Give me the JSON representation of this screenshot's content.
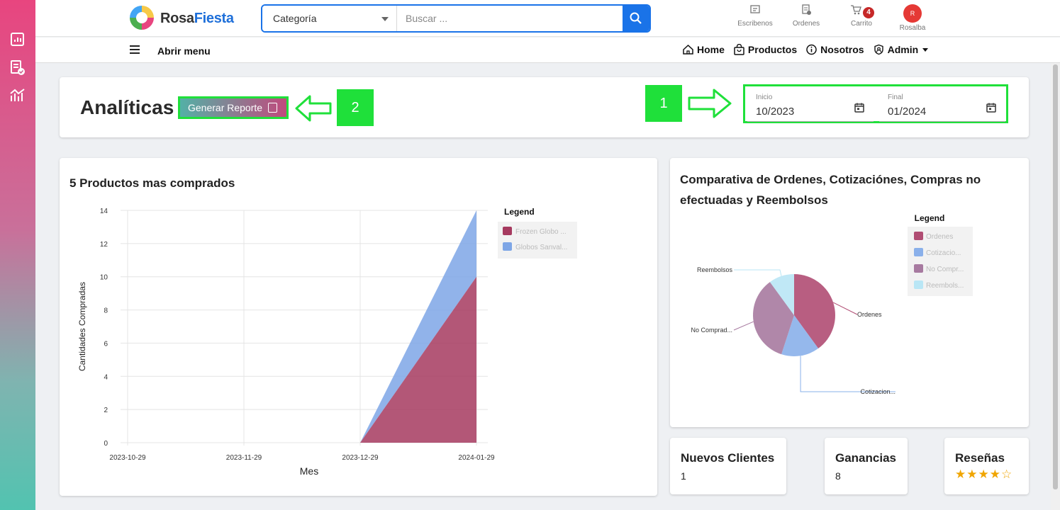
{
  "brand": {
    "part1": "Rosa",
    "part2": "Fiesta"
  },
  "search": {
    "category_label": "Categoría",
    "placeholder": "Buscar ..."
  },
  "header_icons": {
    "escribenos": "Escribenos",
    "ordenes": "Ordenes",
    "carrito": "Carrito",
    "cart_count": "4",
    "user": "Rosalba",
    "avatar_initial": "R"
  },
  "nav": {
    "menu_label": "Abrir menu",
    "home": "Home",
    "productos": "Productos",
    "nosotros": "Nosotros",
    "admin": "Admin"
  },
  "page": {
    "title": "Analíticas",
    "report_button": "Generar Reporte"
  },
  "annotations": {
    "step1": "1",
    "step2": "2"
  },
  "dates": {
    "start_label": "Inicio",
    "start_value": "10/2023",
    "end_label": "Final",
    "end_value": "01/2024"
  },
  "colors": {
    "accent_green": "#1fe03a",
    "series_red": "#a63a5f",
    "series_blue": "#7ea6e6",
    "pie_purple": "#a77aa0",
    "pie_cyan": "#b9e6f5"
  },
  "chart_data": [
    {
      "type": "area",
      "title": "5 Productos mas comprados",
      "xlabel": "Mes",
      "ylabel": "Cantidades Compradas",
      "legend_title": "Legend",
      "stacked": true,
      "x": [
        "2023-10-29",
        "2023-11-29",
        "2023-12-29",
        "2024-01-29"
      ],
      "ylim": [
        0,
        14
      ],
      "yticks": [
        0,
        2,
        4,
        6,
        8,
        10,
        12,
        14
      ],
      "series": [
        {
          "name": "Frozen Globo ...",
          "values": [
            0,
            0,
            0,
            10
          ],
          "color": "#a63a5f"
        },
        {
          "name": "Globos Sanval...",
          "values": [
            0,
            0,
            0,
            4
          ],
          "color": "#7ea6e6"
        }
      ],
      "grid": true,
      "legend_position": "right"
    },
    {
      "type": "pie",
      "title": "Comparativa de Ordenes, Cotizaciónes, Compras no efectuadas y Reembolsos",
      "legend_title": "Legend",
      "legend_position": "right",
      "slices": [
        {
          "name": "Ordenes",
          "legend_label": "Ordenes",
          "slice_label": "Ordenes",
          "value": 40,
          "color": "#b04d73"
        },
        {
          "name": "Cotizaciones",
          "legend_label": "Cotizacio...",
          "slice_label": "Cotizacion...",
          "value": 15,
          "color": "#8ab0ea"
        },
        {
          "name": "No Compradas",
          "legend_label": "No Compr...",
          "slice_label": "No Comprad...",
          "value": 35,
          "color": "#a77aa0"
        },
        {
          "name": "Reembolsos",
          "legend_label": "Reembols...",
          "slice_label": "Reembolsos",
          "value": 10,
          "color": "#b9e6f5"
        }
      ]
    }
  ],
  "stats": {
    "clientes_label": "Nuevos Clientes",
    "clientes_value": "1",
    "ganancias_label": "Ganancias",
    "ganancias_value": "8",
    "resenas_label": "Reseñas",
    "resenas_rating": 4,
    "resenas_max": 5
  }
}
